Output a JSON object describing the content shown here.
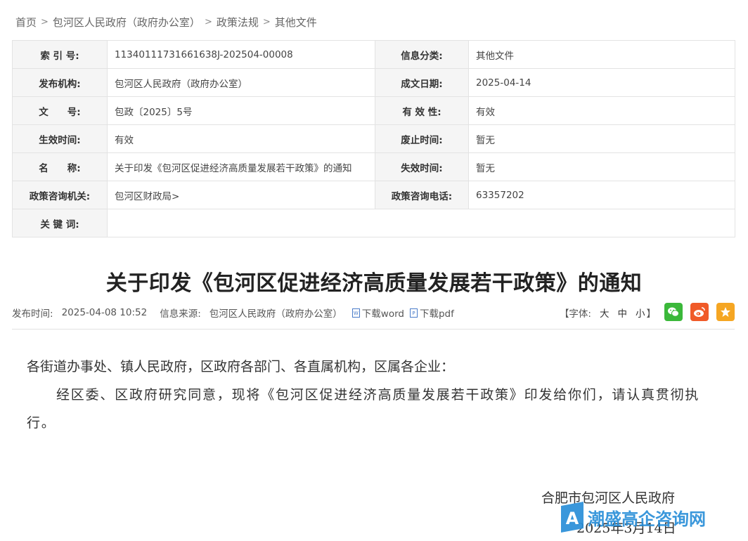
{
  "breadcrumb": [
    "首页",
    "包河区人民政府（政府办公室）",
    "政策法规",
    "其他文件"
  ],
  "info_rows": [
    {
      "k1": "索 引 号:",
      "v1": "11340111731661638J-202504-00008",
      "k2": "信息分类:",
      "v2": "其他文件"
    },
    {
      "k1": "发布机构:",
      "v1": "包河区人民政府（政府办公室）",
      "k2": "成文日期:",
      "v2": "2025-04-14"
    },
    {
      "k1": "文　　号:",
      "v1": "包政〔2025〕5号",
      "k2": "有 效 性:",
      "v2": "有效"
    },
    {
      "k1": "生效时间:",
      "v1": "有效",
      "k2": "废止时间:",
      "v2": "暂无"
    },
    {
      "k1": "名　　称:",
      "v1": "关于印发《包河区促进经济高质量发展若干政策》的通知",
      "k2": "失效时间:",
      "v2": "暂无"
    },
    {
      "k1": "政策咨询机关:",
      "v1": "包河区财政局>",
      "k2": "政策咨询电话:",
      "v2": "63357202"
    }
  ],
  "keywords_label": "关 键 词:",
  "keywords_value": "",
  "article": {
    "title": "关于印发《包河区促进经济高质量发展若干政策》的通知",
    "publish_label": "发布时间:",
    "publish_time": "2025-04-08 10:52",
    "source_label": "信息来源:",
    "source": "包河区人民政府（政府办公室）",
    "download_word": "下载word",
    "download_pdf": "下载pdf",
    "font_label_open": "【字体:",
    "font_large": "大",
    "font_medium": "中",
    "font_small": "小",
    "font_label_close": "】",
    "salutation": "各街道办事处、镇人民政府，区政府各部门、各直属机构，区属各企业：",
    "paragraph": "经区委、区政府研究同意，现将《包河区促进经济高质量发展若干政策》印发给你们，请认真贯彻执行。",
    "signature": "合肥市包河区人民政府",
    "date": "2025年3月14日"
  },
  "watermark_text": "潮盛高企咨询网",
  "colors": {
    "wechat": "#3bb83a",
    "weibo": "#f05a28",
    "favorite": "#f5a623",
    "watermark": "#2a8fd8"
  }
}
